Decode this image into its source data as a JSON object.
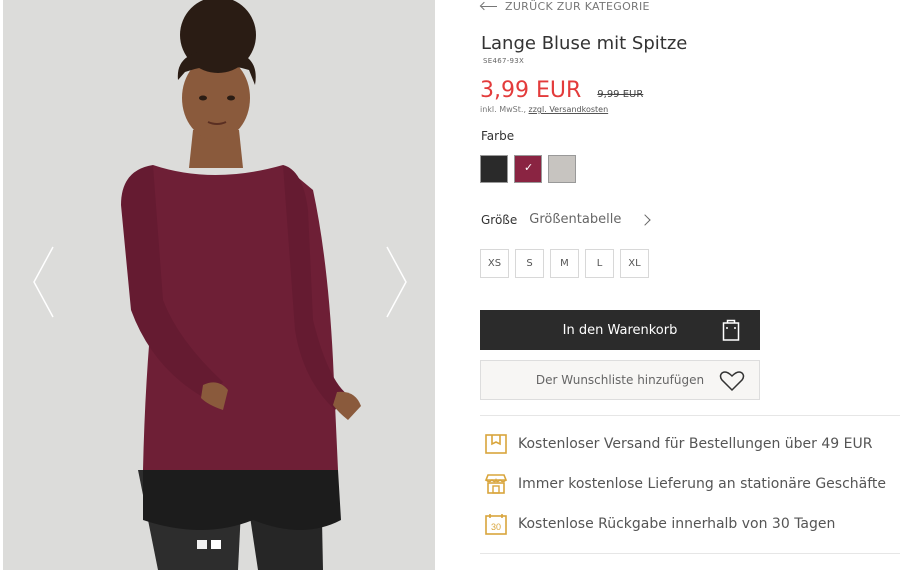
{
  "gallery": {
    "prev_icon": "chevron-left-icon",
    "next_icon": "chevron-right-icon",
    "dots_count": 2,
    "active_dot": 1
  },
  "nav": {
    "back_label": "ZURÜCK ZUR KATEGORIE"
  },
  "product": {
    "title": "Lange Bluse mit Spitze",
    "sku": "SE467-93X",
    "price": "3,99 EUR",
    "old_price": "9,99 EUR",
    "tax_note": "inkl. MwSt.,",
    "shipping_link": "zzgl. Versandkosten",
    "price_color": "#e33b3b"
  },
  "colors": {
    "label": "Farbe",
    "options": [
      {
        "name": "black",
        "hex": "#2a2a2a",
        "selected": false
      },
      {
        "name": "burgundy",
        "hex": "#8a2442",
        "selected": true
      },
      {
        "name": "grey",
        "hex": "#c7c4c0",
        "selected": false
      }
    ]
  },
  "sizes": {
    "label": "Größe",
    "chart_link": "Größentabelle",
    "options": [
      "XS",
      "S",
      "M",
      "L",
      "XL"
    ]
  },
  "actions": {
    "add_to_cart": "In den Warenkorb",
    "add_to_wishlist": "Der Wunschliste hinzufügen"
  },
  "benefits": [
    {
      "icon": "package-icon",
      "text": "Kostenloser Versand für Bestellungen über 49 EUR"
    },
    {
      "icon": "store-icon",
      "text": "Immer kostenlose Lieferung an stationäre Geschäfte"
    },
    {
      "icon": "calendar-30-icon",
      "text": "Kostenlose Rückgabe innerhalb von 30 Tagen",
      "icon_text": "30"
    }
  ]
}
